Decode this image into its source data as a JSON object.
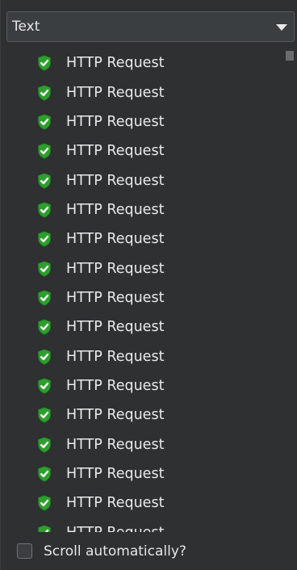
{
  "dropdown": {
    "selected": "Text"
  },
  "list": {
    "items": [
      {
        "label": "HTTP Request"
      },
      {
        "label": "HTTP Request"
      },
      {
        "label": "HTTP Request"
      },
      {
        "label": "HTTP Request"
      },
      {
        "label": "HTTP Request"
      },
      {
        "label": "HTTP Request"
      },
      {
        "label": "HTTP Request"
      },
      {
        "label": "HTTP Request"
      },
      {
        "label": "HTTP Request"
      },
      {
        "label": "HTTP Request"
      },
      {
        "label": "HTTP Request"
      },
      {
        "label": "HTTP Request"
      },
      {
        "label": "HTTP Request"
      },
      {
        "label": "HTTP Request"
      },
      {
        "label": "HTTP Request"
      },
      {
        "label": "HTTP Request"
      },
      {
        "label": "HTTP Request"
      }
    ],
    "item_icon": "shield-check-icon",
    "icon_colors": {
      "shield": "#2e9e2e",
      "check": "#ffffff"
    }
  },
  "footer": {
    "auto_scroll_label": "Scroll automatically?",
    "auto_scroll_checked": false
  }
}
